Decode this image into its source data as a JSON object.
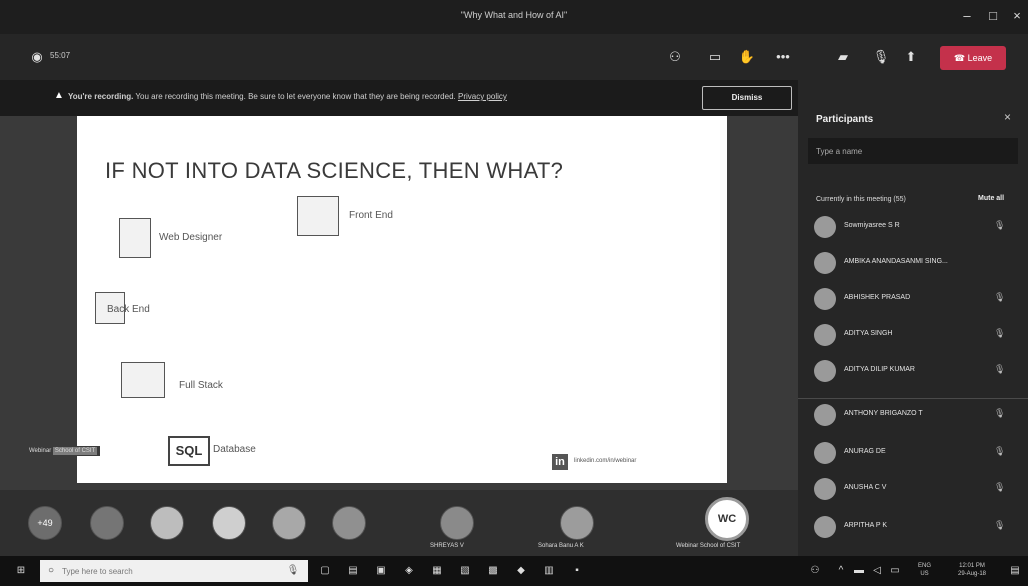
{
  "window": {
    "title": "\"Why What and How of AI\"",
    "minimize_glyph": "–",
    "maximize_glyph": "□",
    "close_glyph": "×"
  },
  "toolbar": {
    "timer": "55:07",
    "leave_label": "Leave"
  },
  "banner": {
    "bold": "You're recording.",
    "text": " You are recording this meeting. Be sure to let everyone know that they are being recorded.",
    "link": "Privacy policy",
    "dismiss_label": "Dismiss"
  },
  "slide": {
    "title": "IF NOT INTO DATA SCIENCE, THEN WHAT?",
    "items": {
      "web_designer": "Web Designer",
      "front_end": "Front End",
      "back_end": "Back End",
      "full_stack": "Full Stack",
      "database": "Database"
    },
    "sql_logo": "SQL",
    "linkedin_logo": "in",
    "linkedin_handle": "linkedin.com/in/webinar"
  },
  "presenter_tag": {
    "prefix": "Webinar ",
    "highlight": "School of CSIT"
  },
  "video_strip": {
    "overflow_count": "+49",
    "tiles": [
      {
        "name": "SHREYAS V"
      },
      {
        "name": "Sohara Banu A K"
      },
      {
        "name": "Webinar School of CSIT"
      }
    ],
    "webinar_initials": "WC"
  },
  "panel": {
    "title": "Participants",
    "close_glyph": "×",
    "search_placeholder": "Type a name",
    "section_heading": "Currently in this meeting (55)",
    "mute_all_label": "Mute all",
    "participants": [
      {
        "name": "Sowmiyasree S R"
      },
      {
        "name": "AMBIKA ANANDASANMI SING..."
      },
      {
        "name": "ABHISHEK PRASAD"
      },
      {
        "name": "ADITYA SINGH"
      },
      {
        "name": "ADITYA DILIP KUMAR"
      },
      {
        "name": "ANTHONY BRIGANZO T"
      },
      {
        "name": "ANURAG DE"
      },
      {
        "name": "ANUSHA C V"
      },
      {
        "name": "ARPITHA P K"
      }
    ]
  },
  "taskbar": {
    "search_placeholder": "Type here to search",
    "lang": "ENG",
    "lang2": "US",
    "time": "12:01 PM",
    "date": "29-Aug-18"
  }
}
